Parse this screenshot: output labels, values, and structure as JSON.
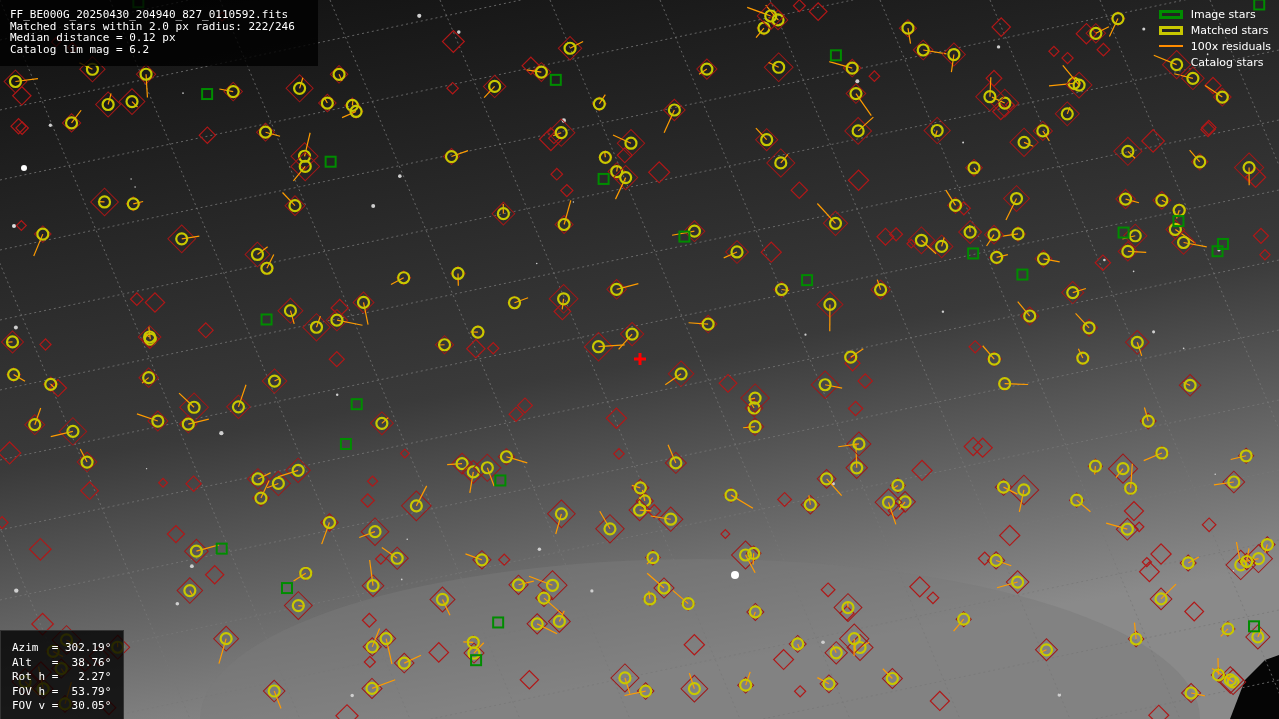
{
  "header": {
    "lines": [
      "FF_BE000G_20250430_204940_827_0110592.fits",
      "Matched stars within 2.0 px radius: 222/246",
      "Median distance = 0.12 px",
      "Catalog lim mag = 6.2"
    ]
  },
  "legend": [
    {
      "kind": "box",
      "label": "Image stars",
      "color": "#008c00"
    },
    {
      "kind": "box",
      "label": "Matched stars",
      "color": "#c8c800"
    },
    {
      "kind": "line",
      "label": "100x residuals",
      "color": "#ff8c00"
    },
    {
      "kind": "none",
      "label": "Catalog stars"
    }
  ],
  "pointing": {
    "lines": [
      "Azim  = 302.19°",
      "Alt   =  38.76°",
      "Rot h =   2.27°",
      "FOV h =  53.79°",
      "FOV v =  30.05°"
    ]
  }
}
